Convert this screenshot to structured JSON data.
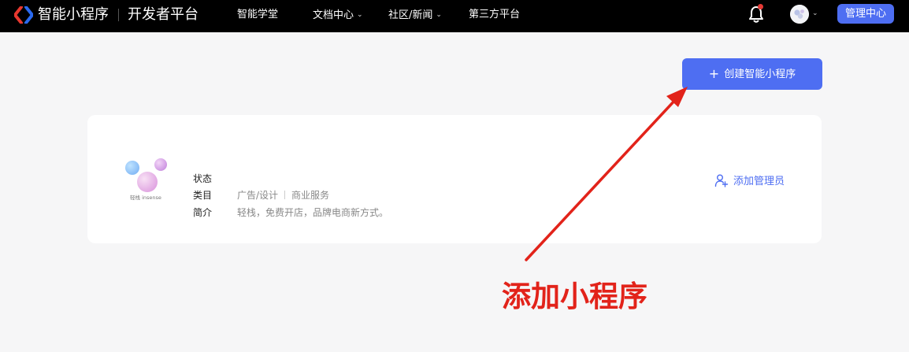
{
  "header": {
    "brand_name": "智能小程序",
    "platform_name": "开发者平台",
    "nav": [
      {
        "label": "智能学堂",
        "has_dropdown": false
      },
      {
        "label": "文档中心",
        "has_dropdown": true
      },
      {
        "label": "社区/新闻",
        "has_dropdown": true
      },
      {
        "label": "第三方平台",
        "has_dropdown": false
      }
    ],
    "admin_center_label": "管理中心",
    "icons": {
      "logo": "brand-logo-icon",
      "bell": "bell-icon",
      "avatar": "avatar"
    },
    "colors": {
      "bar": "#000000",
      "accent": "#4e6ef2",
      "notification_dot": "#e53935"
    }
  },
  "main": {
    "create_button_label": "创建智能小程序",
    "create_button_icon": "plus-icon"
  },
  "app_card": {
    "logo_text": "轻栈 insense",
    "status_label": "状态",
    "status_value": "",
    "category_label": "类目",
    "categories": [
      "广告/设计",
      "商业服务"
    ],
    "intro_label": "简介",
    "intro_value": "轻栈，免费开店，品牌电商新方式。",
    "add_admin_label": "添加管理员",
    "add_admin_icon": "add-user-icon"
  },
  "annotation": {
    "text": "添加小程序",
    "color": "#e2231a"
  }
}
